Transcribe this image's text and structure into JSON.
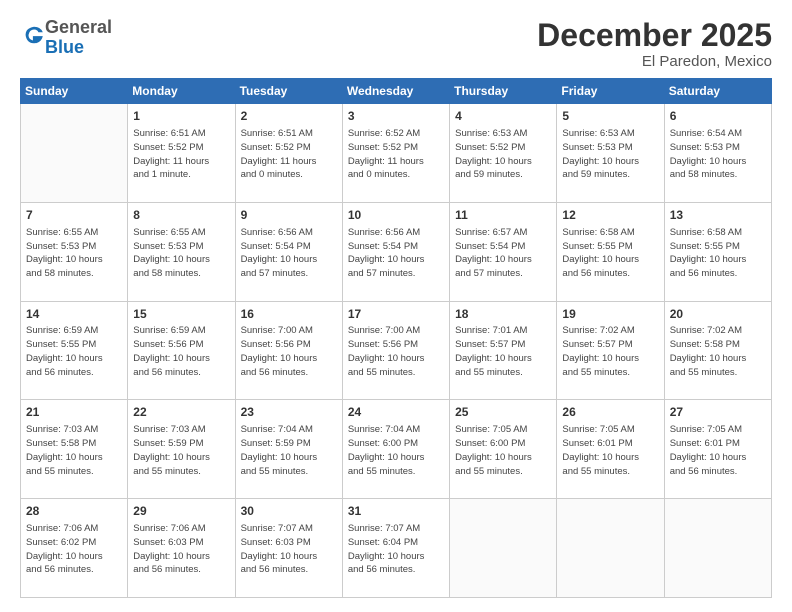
{
  "logo": {
    "line1": "General",
    "line2": "Blue"
  },
  "header": {
    "month": "December 2025",
    "location": "El Paredon, Mexico"
  },
  "weekdays": [
    "Sunday",
    "Monday",
    "Tuesday",
    "Wednesday",
    "Thursday",
    "Friday",
    "Saturday"
  ],
  "weeks": [
    [
      {
        "day": "",
        "info": ""
      },
      {
        "day": "1",
        "info": "Sunrise: 6:51 AM\nSunset: 5:52 PM\nDaylight: 11 hours\nand 1 minute."
      },
      {
        "day": "2",
        "info": "Sunrise: 6:51 AM\nSunset: 5:52 PM\nDaylight: 11 hours\nand 0 minutes."
      },
      {
        "day": "3",
        "info": "Sunrise: 6:52 AM\nSunset: 5:52 PM\nDaylight: 11 hours\nand 0 minutes."
      },
      {
        "day": "4",
        "info": "Sunrise: 6:53 AM\nSunset: 5:52 PM\nDaylight: 10 hours\nand 59 minutes."
      },
      {
        "day": "5",
        "info": "Sunrise: 6:53 AM\nSunset: 5:53 PM\nDaylight: 10 hours\nand 59 minutes."
      },
      {
        "day": "6",
        "info": "Sunrise: 6:54 AM\nSunset: 5:53 PM\nDaylight: 10 hours\nand 58 minutes."
      }
    ],
    [
      {
        "day": "7",
        "info": "Sunrise: 6:55 AM\nSunset: 5:53 PM\nDaylight: 10 hours\nand 58 minutes."
      },
      {
        "day": "8",
        "info": "Sunrise: 6:55 AM\nSunset: 5:53 PM\nDaylight: 10 hours\nand 58 minutes."
      },
      {
        "day": "9",
        "info": "Sunrise: 6:56 AM\nSunset: 5:54 PM\nDaylight: 10 hours\nand 57 minutes."
      },
      {
        "day": "10",
        "info": "Sunrise: 6:56 AM\nSunset: 5:54 PM\nDaylight: 10 hours\nand 57 minutes."
      },
      {
        "day": "11",
        "info": "Sunrise: 6:57 AM\nSunset: 5:54 PM\nDaylight: 10 hours\nand 57 minutes."
      },
      {
        "day": "12",
        "info": "Sunrise: 6:58 AM\nSunset: 5:55 PM\nDaylight: 10 hours\nand 56 minutes."
      },
      {
        "day": "13",
        "info": "Sunrise: 6:58 AM\nSunset: 5:55 PM\nDaylight: 10 hours\nand 56 minutes."
      }
    ],
    [
      {
        "day": "14",
        "info": "Sunrise: 6:59 AM\nSunset: 5:55 PM\nDaylight: 10 hours\nand 56 minutes."
      },
      {
        "day": "15",
        "info": "Sunrise: 6:59 AM\nSunset: 5:56 PM\nDaylight: 10 hours\nand 56 minutes."
      },
      {
        "day": "16",
        "info": "Sunrise: 7:00 AM\nSunset: 5:56 PM\nDaylight: 10 hours\nand 56 minutes."
      },
      {
        "day": "17",
        "info": "Sunrise: 7:00 AM\nSunset: 5:56 PM\nDaylight: 10 hours\nand 55 minutes."
      },
      {
        "day": "18",
        "info": "Sunrise: 7:01 AM\nSunset: 5:57 PM\nDaylight: 10 hours\nand 55 minutes."
      },
      {
        "day": "19",
        "info": "Sunrise: 7:02 AM\nSunset: 5:57 PM\nDaylight: 10 hours\nand 55 minutes."
      },
      {
        "day": "20",
        "info": "Sunrise: 7:02 AM\nSunset: 5:58 PM\nDaylight: 10 hours\nand 55 minutes."
      }
    ],
    [
      {
        "day": "21",
        "info": "Sunrise: 7:03 AM\nSunset: 5:58 PM\nDaylight: 10 hours\nand 55 minutes."
      },
      {
        "day": "22",
        "info": "Sunrise: 7:03 AM\nSunset: 5:59 PM\nDaylight: 10 hours\nand 55 minutes."
      },
      {
        "day": "23",
        "info": "Sunrise: 7:04 AM\nSunset: 5:59 PM\nDaylight: 10 hours\nand 55 minutes."
      },
      {
        "day": "24",
        "info": "Sunrise: 7:04 AM\nSunset: 6:00 PM\nDaylight: 10 hours\nand 55 minutes."
      },
      {
        "day": "25",
        "info": "Sunrise: 7:05 AM\nSunset: 6:00 PM\nDaylight: 10 hours\nand 55 minutes."
      },
      {
        "day": "26",
        "info": "Sunrise: 7:05 AM\nSunset: 6:01 PM\nDaylight: 10 hours\nand 55 minutes."
      },
      {
        "day": "27",
        "info": "Sunrise: 7:05 AM\nSunset: 6:01 PM\nDaylight: 10 hours\nand 56 minutes."
      }
    ],
    [
      {
        "day": "28",
        "info": "Sunrise: 7:06 AM\nSunset: 6:02 PM\nDaylight: 10 hours\nand 56 minutes."
      },
      {
        "day": "29",
        "info": "Sunrise: 7:06 AM\nSunset: 6:03 PM\nDaylight: 10 hours\nand 56 minutes."
      },
      {
        "day": "30",
        "info": "Sunrise: 7:07 AM\nSunset: 6:03 PM\nDaylight: 10 hours\nand 56 minutes."
      },
      {
        "day": "31",
        "info": "Sunrise: 7:07 AM\nSunset: 6:04 PM\nDaylight: 10 hours\nand 56 minutes."
      },
      {
        "day": "",
        "info": ""
      },
      {
        "day": "",
        "info": ""
      },
      {
        "day": "",
        "info": ""
      }
    ]
  ]
}
